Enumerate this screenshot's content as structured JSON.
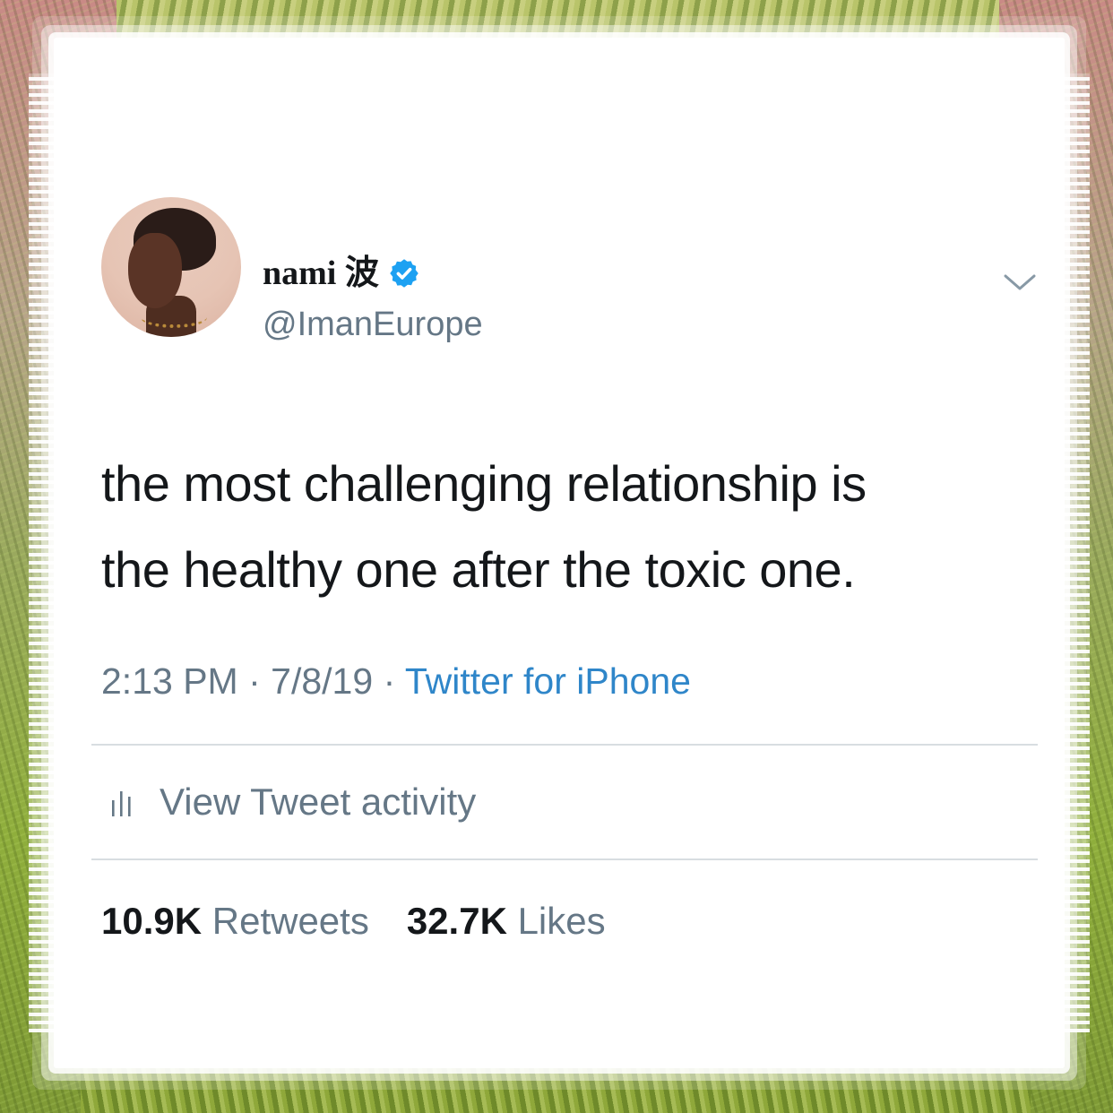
{
  "tweet": {
    "author": {
      "display_name": "nami 波",
      "handle": "@ImanEurope",
      "verified": true
    },
    "text_lines": [
      "the most challenging relationship is",
      "the healthy one after the toxic one."
    ],
    "time": "2:13 PM",
    "date": "7/8/19",
    "separator": "·",
    "source": "Twitter for iPhone",
    "activity_label": "View Tweet activity",
    "retweets": {
      "count": "10.9K",
      "label": "Retweets"
    },
    "likes": {
      "count": "32.7K",
      "label": "Likes"
    }
  },
  "icons": {
    "verified": "verified-badge-icon",
    "menu": "chevron-down-icon",
    "activity": "bar-chart-icon"
  },
  "colors": {
    "text_primary": "#14171a",
    "text_secondary": "#657786",
    "link": "#2f86c9",
    "verified": "#1da1f2",
    "divider": "#d8dde1"
  }
}
